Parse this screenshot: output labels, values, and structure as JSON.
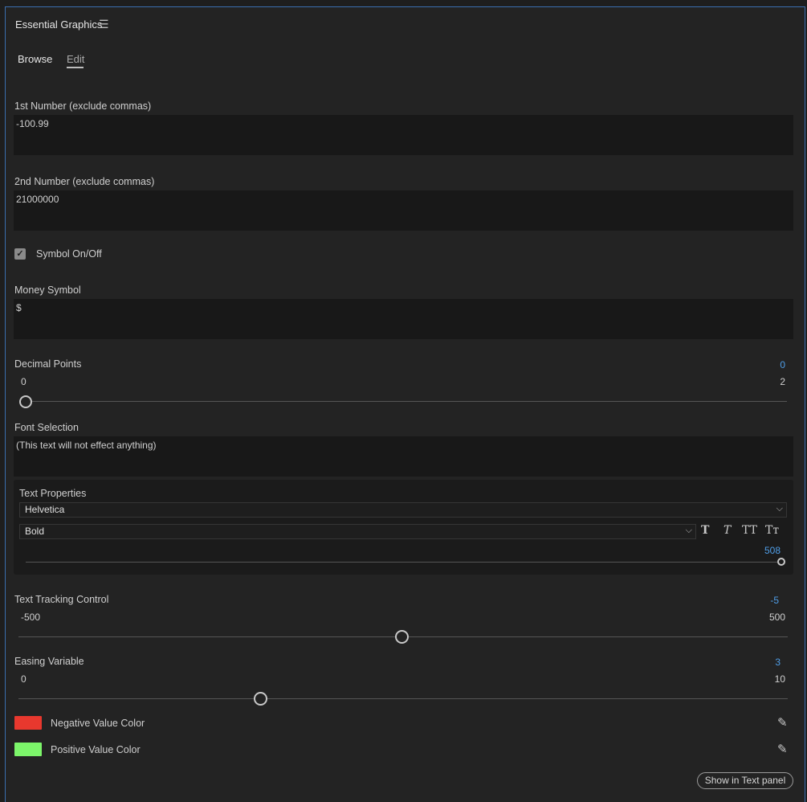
{
  "panel": {
    "title": "Essential Graphics",
    "menu_icon": "hamburger-menu-icon"
  },
  "tabs": [
    {
      "label": "Browse",
      "active": false
    },
    {
      "label": "Edit",
      "active": true
    }
  ],
  "fields": {
    "first_number": {
      "label": "1st Number (exclude commas)",
      "value": "-100.99"
    },
    "second_number": {
      "label": "2nd Number (exclude commas)",
      "value": "21000000"
    },
    "money_symbol": {
      "label": "Money Symbol",
      "value": "$"
    },
    "font_selection": {
      "label": "Font Selection",
      "value": "(This text will not effect anything)"
    }
  },
  "symbol_toggle": {
    "label": "Symbol On/Off",
    "checked": true,
    "check_glyph": "✓"
  },
  "decimal_points": {
    "label": "Decimal Points",
    "value": "0",
    "min": "0",
    "max": "2"
  },
  "text_properties": {
    "label": "Text Properties",
    "font_family": "Helvetica",
    "font_style": "Bold",
    "size_value": "508",
    "format_buttons": {
      "faux_bold": "T",
      "faux_italic": "T",
      "all_caps": "TT",
      "small_caps": "Tт"
    }
  },
  "text_tracking": {
    "label": "Text Tracking Control",
    "value": "-5",
    "min": "-500",
    "max": "500"
  },
  "easing_variable": {
    "label": "Easing Variable",
    "value": "3",
    "min": "0",
    "max": "10"
  },
  "colors": {
    "negative": {
      "label": "Negative Value Color",
      "hex": "#e8382e"
    },
    "positive": {
      "label": "Positive Value Color",
      "hex": "#7cf56a"
    }
  },
  "footer": {
    "show_button": "Show in Text panel"
  },
  "theme": {
    "accent": "#4f9ee8",
    "border": "#3a6fb0"
  }
}
